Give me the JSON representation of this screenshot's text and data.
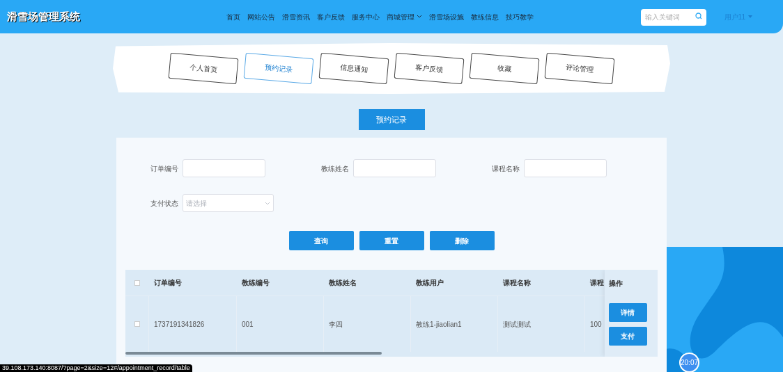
{
  "header": {
    "title": "滑雪场管理系统",
    "nav": [
      {
        "label": "首页",
        "dropdown": false
      },
      {
        "label": "网站公告",
        "dropdown": false
      },
      {
        "label": "滑雪资讯",
        "dropdown": false
      },
      {
        "label": "客户反馈",
        "dropdown": false
      },
      {
        "label": "服务中心",
        "dropdown": false
      },
      {
        "label": "商城管理",
        "dropdown": true
      },
      {
        "label": "滑雪场设施",
        "dropdown": false
      },
      {
        "label": "教练信息",
        "dropdown": false
      },
      {
        "label": "技巧教学",
        "dropdown": false
      }
    ],
    "search": {
      "placeholder": "输入关键词"
    },
    "user": "用户11"
  },
  "tabs": [
    {
      "label": "个人首页",
      "selected": false
    },
    {
      "label": "预约记录",
      "selected": true
    },
    {
      "label": "信息通知",
      "selected": false
    },
    {
      "label": "客户反馈",
      "selected": false
    },
    {
      "label": "收藏",
      "selected": false
    },
    {
      "label": "评论管理",
      "selected": false
    }
  ],
  "page_title": "预约记录",
  "filters": [
    {
      "label": "订单编号",
      "kind": "input"
    },
    {
      "label": "教练姓名",
      "kind": "input"
    },
    {
      "label": "课程名称",
      "kind": "input"
    },
    {
      "label": "支付状态",
      "kind": "select",
      "placeholder": "请选择"
    }
  ],
  "actions": [
    "查询",
    "重置",
    "删除"
  ],
  "table": {
    "select_all_checked": false,
    "columns": [
      "订单编号",
      "教练编号",
      "教练姓名",
      "教练用户",
      "课程名称",
      "课程"
    ],
    "action_column": "操作",
    "rows": [
      {
        "checked": false,
        "cells": [
          "1737191341826",
          "001",
          "李四",
          "教练1-jiaolian1",
          "测试测试",
          "100"
        ],
        "actions": [
          "详情",
          "支付"
        ]
      }
    ]
  },
  "status_url": "39.108.173.140:8087/?page=2&size=12#/appointment_record/table",
  "clock": "20:07"
}
